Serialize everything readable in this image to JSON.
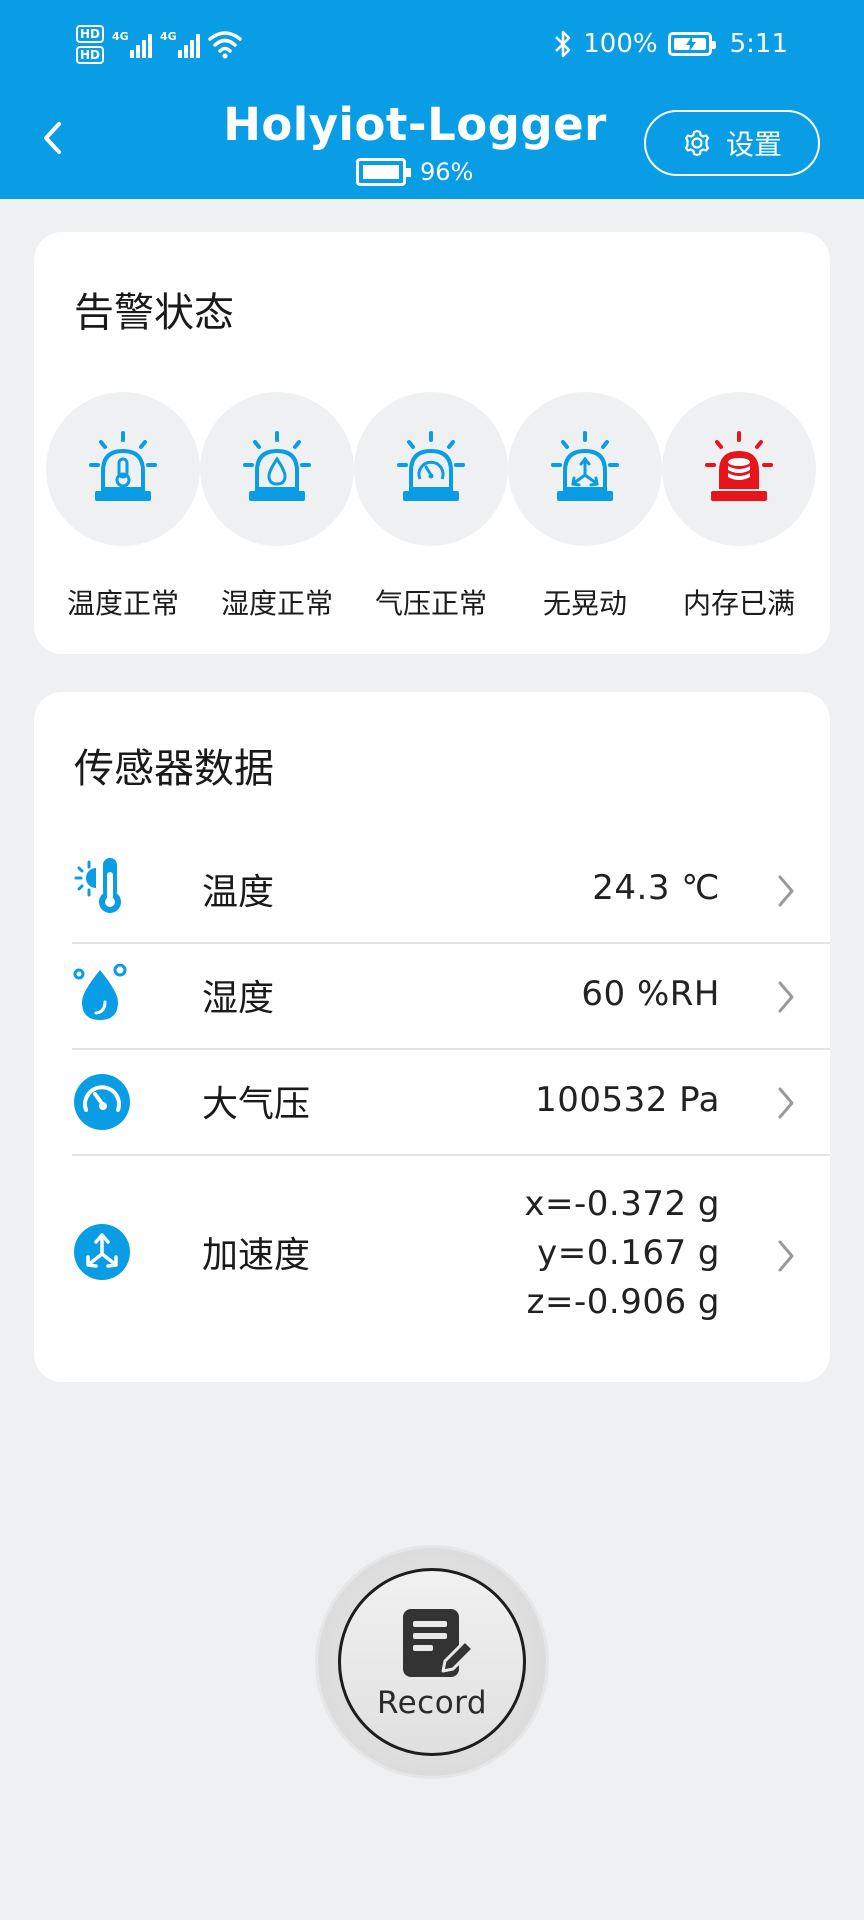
{
  "status_bar": {
    "hd1": "HD",
    "hd2": "HD",
    "net1": "4G",
    "net2": "4G",
    "battery_percent": "100%",
    "time": "5:11"
  },
  "header": {
    "title": "Holyiot-Logger",
    "device_battery": "96%",
    "settings_label": "设置",
    "accent_color": "#089de4"
  },
  "alarm": {
    "title": "告警状态",
    "items": [
      {
        "label": "温度正常",
        "icon": "thermometer-siren-icon",
        "color": "#089de4"
      },
      {
        "label": "湿度正常",
        "icon": "humidity-siren-icon",
        "color": "#089de4"
      },
      {
        "label": "气压正常",
        "icon": "pressure-siren-icon",
        "color": "#089de4"
      },
      {
        "label": "无晃动",
        "icon": "motion-siren-icon",
        "color": "#089de4"
      },
      {
        "label": "内存已满",
        "icon": "memory-siren-icon",
        "color": "#e8141b"
      }
    ]
  },
  "sensors": {
    "title": "传感器数据",
    "rows": [
      {
        "name": "温度",
        "value": "24.3 ℃",
        "icon": "thermometer-icon"
      },
      {
        "name": "湿度",
        "value": "60 %RH",
        "icon": "humidity-drop-icon"
      },
      {
        "name": "大气压",
        "value": "100532 Pa",
        "icon": "pressure-gauge-icon"
      },
      {
        "name": "加速度",
        "values": [
          "x=-0.372 g",
          "y=0.167 g",
          "z=-0.906 g"
        ],
        "icon": "acceleration-icon"
      }
    ]
  },
  "record": {
    "label": "Record"
  }
}
